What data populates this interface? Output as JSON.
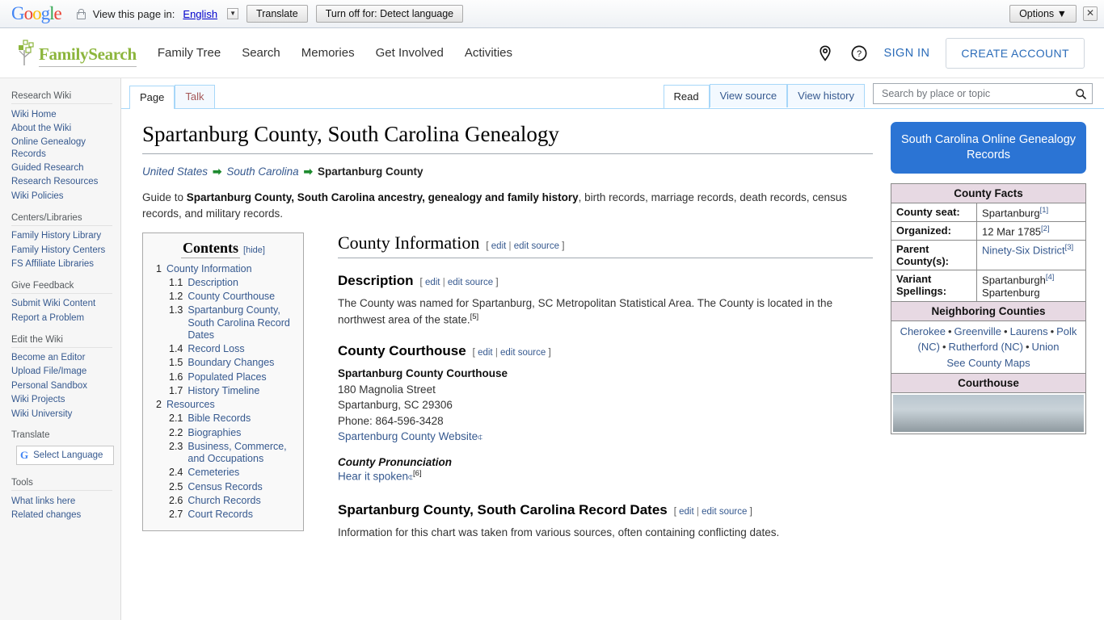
{
  "translate_bar": {
    "logo": "Google",
    "lock_icon": "lock-icon",
    "prompt": "View this page in:",
    "language": "English",
    "translate_button": "Translate",
    "turnoff_button": "Turn off for: Detect language",
    "options_button": "Options ▼",
    "close_button": "✕"
  },
  "header": {
    "brand": "FamilySearch",
    "nav": [
      {
        "label": "Family Tree"
      },
      {
        "label": "Search"
      },
      {
        "label": "Memories"
      },
      {
        "label": "Get Involved"
      },
      {
        "label": "Activities"
      }
    ],
    "map_icon": "map-pin-icon",
    "help_icon": "help-circle-icon",
    "sign_in": "SIGN IN",
    "create_account": "CREATE ACCOUNT"
  },
  "sidebar": {
    "groups": [
      {
        "heading": "Research Wiki",
        "items": [
          {
            "label": "Wiki Home"
          },
          {
            "label": "About the Wiki"
          },
          {
            "label": "Online Genealogy Records"
          },
          {
            "label": "Guided Research"
          },
          {
            "label": "Research Resources"
          },
          {
            "label": "Wiki Policies"
          }
        ]
      },
      {
        "heading": "Centers/Libraries",
        "items": [
          {
            "label": "Family History Library"
          },
          {
            "label": "Family History Centers"
          },
          {
            "label": "FS Affiliate Libraries"
          }
        ]
      },
      {
        "heading": "Give Feedback",
        "items": [
          {
            "label": "Submit Wiki Content"
          },
          {
            "label": "Report a Problem"
          }
        ]
      },
      {
        "heading": "Edit the Wiki",
        "items": [
          {
            "label": "Become an Editor"
          },
          {
            "label": "Upload File/Image"
          },
          {
            "label": "Personal Sandbox"
          },
          {
            "label": "Wiki Projects"
          },
          {
            "label": "Wiki University"
          }
        ]
      }
    ],
    "translate_heading": "Translate",
    "select_language": "Select Language",
    "tools_heading": "Tools",
    "tools_items": [
      {
        "label": "What links here"
      },
      {
        "label": "Related changes"
      }
    ]
  },
  "tabs": {
    "left": [
      {
        "label": "Page",
        "selected": true
      },
      {
        "label": "Talk",
        "selected": false
      }
    ],
    "right": [
      {
        "label": "Read",
        "selected": true
      },
      {
        "label": "View source",
        "selected": false
      },
      {
        "label": "View history",
        "selected": false
      }
    ],
    "search_placeholder": "Search by place or topic",
    "search_value": "",
    "search_icon": "search-icon"
  },
  "article": {
    "title": "Spartanburg County, South Carolina Genealogy",
    "breadcrumb": {
      "items": [
        {
          "label": "United States",
          "link": true
        },
        {
          "label": "South Carolina",
          "link": true
        },
        {
          "label": "Spartanburg County",
          "link": false
        }
      ],
      "arrow": "➡"
    },
    "intro_prefix": "Guide to ",
    "intro_bold": "Spartanburg County, South Carolina ancestry, genealogy and family history",
    "intro_suffix": ", birth records, marriage records, death records, census records, and military records.",
    "toc": {
      "title": "Contents",
      "toggle": "[hide]",
      "entries": [
        {
          "num": "1",
          "text": "County Information",
          "level": 1
        },
        {
          "num": "1.1",
          "text": "Description",
          "level": 2
        },
        {
          "num": "1.2",
          "text": "County Courthouse",
          "level": 2
        },
        {
          "num": "1.3",
          "text": "Spartanburg County, South Carolina Record Dates",
          "level": 2
        },
        {
          "num": "1.4",
          "text": "Record Loss",
          "level": 2
        },
        {
          "num": "1.5",
          "text": "Boundary Changes",
          "level": 2
        },
        {
          "num": "1.6",
          "text": "Populated Places",
          "level": 2
        },
        {
          "num": "1.7",
          "text": "History Timeline",
          "level": 2
        },
        {
          "num": "2",
          "text": "Resources",
          "level": 1
        },
        {
          "num": "2.1",
          "text": "Bible Records",
          "level": 2
        },
        {
          "num": "2.2",
          "text": "Biographies",
          "level": 2
        },
        {
          "num": "2.3",
          "text": "Business, Commerce, and Occupations",
          "level": 2
        },
        {
          "num": "2.4",
          "text": "Cemeteries",
          "level": 2
        },
        {
          "num": "2.5",
          "text": "Census Records",
          "level": 2
        },
        {
          "num": "2.6",
          "text": "Church Records",
          "level": 2
        },
        {
          "num": "2.7",
          "text": "Court Records",
          "level": 2
        }
      ]
    },
    "edit_links": {
      "open": "[",
      "edit": "edit",
      "sep": "|",
      "edit_source": "edit source",
      "close": "]"
    },
    "sections": {
      "county_information": {
        "heading": "County Information"
      },
      "description": {
        "heading": "Description",
        "body": "The County was named for Spartanburg, SC Metropolitan Statistical Area. The County is located in the northwest area of the state.",
        "ref": "[5]"
      },
      "county_courthouse": {
        "heading": "County Courthouse",
        "name": "Spartanburg County Courthouse",
        "street": "180 Magnolia Street",
        "city_state_zip": "Spartanburg, SC 29306",
        "phone": "Phone: 864-596-3428",
        "website_link": "Spartenburg County Website",
        "pronunciation_label": "County Pronunciation",
        "pronunciation_link": "Hear it spoken",
        "pronunciation_ref": "[6]"
      },
      "record_dates": {
        "heading": "Spartanburg County, South Carolina Record Dates",
        "body": "Information for this chart was taken from various sources, often containing conflicting dates."
      }
    }
  },
  "rail": {
    "online_records_button": "South Carolina Online Genealogy Records",
    "online_records_button_color": "#2b74d4",
    "county_facts": {
      "heading": "County Facts",
      "rows": [
        {
          "label": "County seat:",
          "value": "Spartanburg",
          "ref": "[1]",
          "link": false
        },
        {
          "label": "Organized:",
          "value": "12 Mar 1785",
          "ref": "[2]",
          "link": false
        },
        {
          "label": "Parent County(s):",
          "value": "Ninety-Six District",
          "ref": "[3]",
          "link": true
        },
        {
          "label": "Variant Spellings:",
          "value": "Spartanburgh",
          "ref": "[4]",
          "value2": "Spartenburg",
          "link": false
        }
      ]
    },
    "neighboring": {
      "heading": "Neighboring Counties",
      "counties": [
        "Cherokee",
        "Greenville",
        "Laurens",
        "Polk (NC)",
        "Rutherford (NC)",
        "Union"
      ],
      "see_maps": "See County Maps",
      "separator": "•"
    },
    "courthouse": {
      "heading": "Courthouse"
    }
  }
}
